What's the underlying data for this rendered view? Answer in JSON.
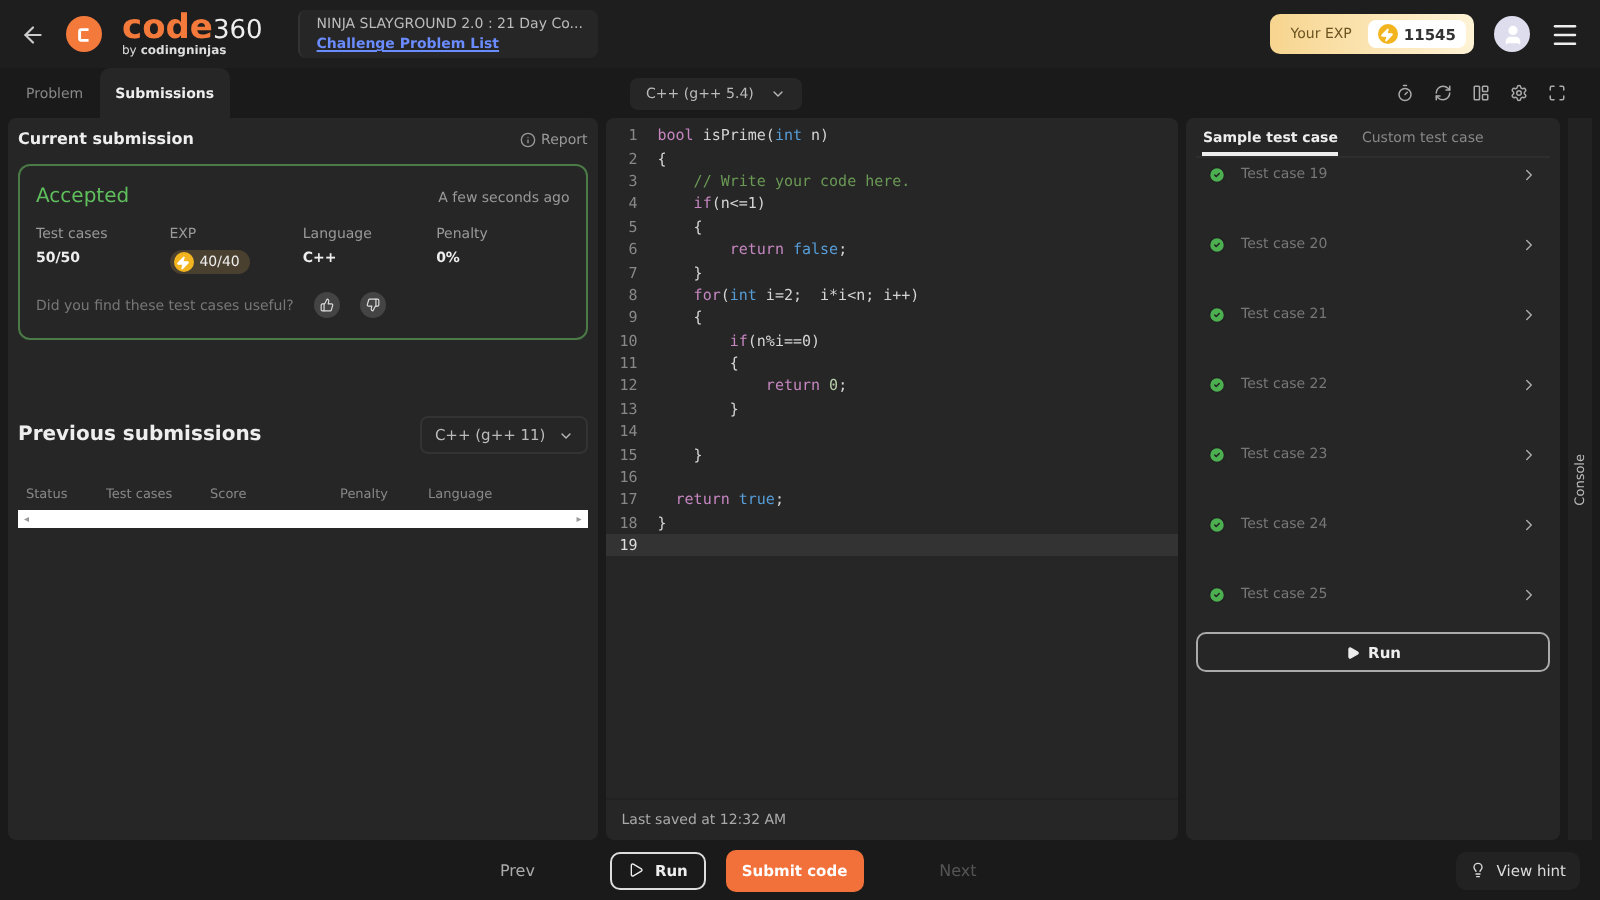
{
  "header": {
    "logo_main": "code",
    "logo_num": "360",
    "logo_sub": "by",
    "logo_brand": "codingninjas",
    "contest_title": "NINJA SLAYGROUND 2.0 : 21 Day Co...",
    "contest_link": "Challenge Problem List",
    "exp_label": "Your EXP",
    "exp_value": "11545"
  },
  "left_tabs": [
    {
      "label": "Problem",
      "selected": false
    },
    {
      "label": "Submissions",
      "selected": true
    }
  ],
  "language_select": "C++ (g++ 5.4)",
  "current_submission": {
    "title": "Current submission",
    "report": "Report",
    "status": "Accepted",
    "time": "A few seconds ago",
    "stats": [
      {
        "label": "Test cases",
        "value": "50/50",
        "kind": "text"
      },
      {
        "label": "EXP",
        "value": "40/40",
        "kind": "exp"
      },
      {
        "label": "Language",
        "value": "C++",
        "kind": "text"
      },
      {
        "label": "Penalty",
        "value": "0%",
        "kind": "text"
      }
    ],
    "feedback": "Did you find these test cases useful?"
  },
  "previous_submissions": {
    "title": "Previous submissions",
    "filter": "C++ (g++ 11)",
    "columns": [
      "Status",
      "Test cases",
      "Score",
      "Penalty",
      "Language"
    ],
    "scroll_left": "◂",
    "scroll_right": "▸"
  },
  "code_lines": [
    {
      "number": "1",
      "tokens": [
        {
          "kind": "keyword",
          "text": "bool"
        },
        {
          "kind": "plain",
          "text": " isPrime("
        },
        {
          "kind": "type",
          "text": "int"
        },
        {
          "kind": "plain",
          "text": " n)"
        }
      ]
    },
    {
      "number": "2",
      "tokens": [
        {
          "kind": "plain",
          "text": "{"
        }
      ]
    },
    {
      "number": "3",
      "tokens": [
        {
          "kind": "comment",
          "text": "    // Write your code here."
        }
      ]
    },
    {
      "number": "4",
      "tokens": [
        {
          "kind": "keyword",
          "text": "    if"
        },
        {
          "kind": "plain",
          "text": "(n<=1)"
        }
      ]
    },
    {
      "number": "5",
      "tokens": [
        {
          "kind": "plain",
          "text": "    {"
        }
      ]
    },
    {
      "number": "6",
      "tokens": [
        {
          "kind": "keyword",
          "text": "        return "
        },
        {
          "kind": "type",
          "text": "false"
        },
        {
          "kind": "plain",
          "text": ";"
        }
      ]
    },
    {
      "number": "7",
      "tokens": [
        {
          "kind": "plain",
          "text": "    }"
        }
      ]
    },
    {
      "number": "8",
      "tokens": [
        {
          "kind": "keyword",
          "text": "    for"
        },
        {
          "kind": "plain",
          "text": "("
        },
        {
          "kind": "type",
          "text": "int"
        },
        {
          "kind": "plain",
          "text": " i=2;  i*i<n; i++)"
        }
      ]
    },
    {
      "number": "9",
      "tokens": [
        {
          "kind": "plain",
          "text": "    {"
        }
      ]
    },
    {
      "number": "10",
      "tokens": [
        {
          "kind": "keyword",
          "text": "        if"
        },
        {
          "kind": "plain",
          "text": "(n%i==0)"
        }
      ]
    },
    {
      "number": "11",
      "tokens": [
        {
          "kind": "plain",
          "text": "        {"
        }
      ]
    },
    {
      "number": "12",
      "tokens": [
        {
          "kind": "keyword",
          "text": "            return "
        },
        {
          "kind": "number",
          "text": "0"
        },
        {
          "kind": "plain",
          "text": ";"
        }
      ]
    },
    {
      "number": "13",
      "tokens": [
        {
          "kind": "plain",
          "text": "        }"
        }
      ]
    },
    {
      "number": "14"
    },
    {
      "number": "15",
      "tokens": [
        {
          "kind": "plain",
          "text": "    }"
        }
      ]
    },
    {
      "number": "16"
    },
    {
      "number": "17",
      "tokens": [
        {
          "kind": "keyword",
          "text": "  return "
        },
        {
          "kind": "type",
          "text": "true"
        },
        {
          "kind": "plain",
          "text": ";"
        }
      ]
    },
    {
      "number": "18",
      "tokens": [
        {
          "kind": "plain",
          "text": "}"
        }
      ]
    },
    {
      "number": "19",
      "current": true
    }
  ],
  "last_saved": "Last saved at 12:32 AM",
  "right_tabs": [
    {
      "label": "Sample test case",
      "selected": true
    },
    {
      "label": "Custom test case",
      "selected": false
    }
  ],
  "test_cases": [
    {
      "label": "Test case 19",
      "passed": true
    },
    {
      "label": "Test case 20",
      "passed": true
    },
    {
      "label": "Test case 21",
      "passed": true
    },
    {
      "label": "Test case 22",
      "passed": true
    },
    {
      "label": "Test case 23",
      "passed": true
    },
    {
      "label": "Test case 24",
      "passed": true
    },
    {
      "label": "Test case 25",
      "passed": true
    }
  ],
  "run_tests": "Run",
  "console": "Console",
  "footer": {
    "prev": {
      "label": "Prev",
      "disabled": false
    },
    "run": "Run",
    "submit": "Submit code",
    "next": {
      "label": "Next",
      "disabled": true
    },
    "hint": "View hint"
  }
}
